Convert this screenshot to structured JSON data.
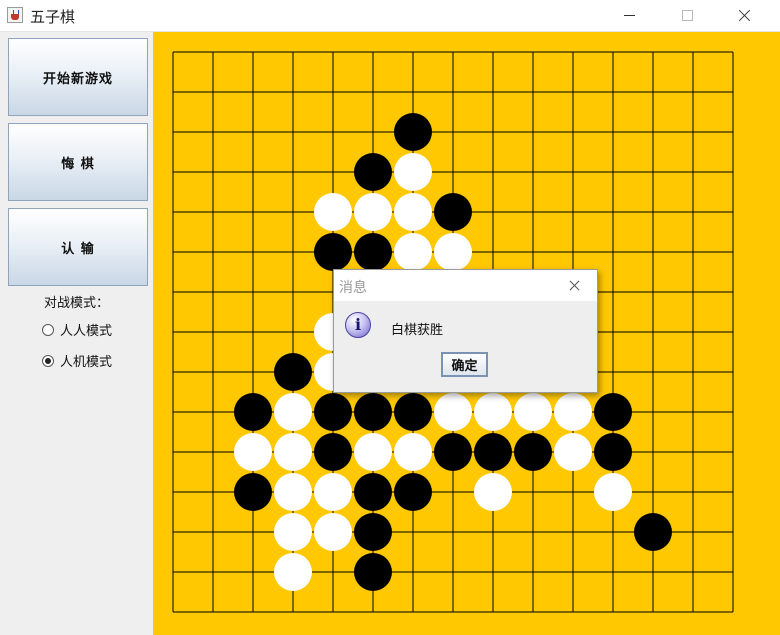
{
  "window": {
    "title": "五子棋"
  },
  "sidebar": {
    "buttons": [
      "开始新游戏",
      "悔 棋",
      "认 输"
    ],
    "mode_label": "对战模式：",
    "modes": [
      {
        "label": "人人模式",
        "selected": false
      },
      {
        "label": "人机模式",
        "selected": true
      }
    ]
  },
  "board": {
    "size": 15,
    "colors": {
      "board": "#ffc800",
      "line": "#000000",
      "black": "#000000",
      "white": "#ffffff"
    },
    "black_stones": [
      [
        6,
        2
      ],
      [
        5,
        3
      ],
      [
        7,
        4
      ],
      [
        4,
        5
      ],
      [
        5,
        5
      ],
      [
        3,
        8
      ],
      [
        2,
        9
      ],
      [
        4,
        9
      ],
      [
        5,
        9
      ],
      [
        6,
        9
      ],
      [
        11,
        9
      ],
      [
        4,
        10
      ],
      [
        7,
        10
      ],
      [
        8,
        10
      ],
      [
        9,
        10
      ],
      [
        11,
        10
      ],
      [
        2,
        11
      ],
      [
        5,
        11
      ],
      [
        6,
        11
      ],
      [
        5,
        12
      ],
      [
        12,
        12
      ],
      [
        5,
        13
      ]
    ],
    "white_stones": [
      [
        6,
        3
      ],
      [
        4,
        4
      ],
      [
        5,
        4
      ],
      [
        6,
        4
      ],
      [
        6,
        5
      ],
      [
        7,
        5
      ],
      [
        4,
        7
      ],
      [
        4,
        8
      ],
      [
        3,
        9
      ],
      [
        7,
        9
      ],
      [
        8,
        9
      ],
      [
        9,
        9
      ],
      [
        10,
        9
      ],
      [
        2,
        10
      ],
      [
        3,
        10
      ],
      [
        5,
        10
      ],
      [
        6,
        10
      ],
      [
        10,
        10
      ],
      [
        3,
        11
      ],
      [
        4,
        11
      ],
      [
        8,
        11
      ],
      [
        11,
        11
      ],
      [
        3,
        12
      ],
      [
        4,
        12
      ],
      [
        3,
        13
      ]
    ]
  },
  "dialog": {
    "title": "消息",
    "icon": "info-icon",
    "message": "白棋获胜",
    "ok_label": "确定"
  }
}
